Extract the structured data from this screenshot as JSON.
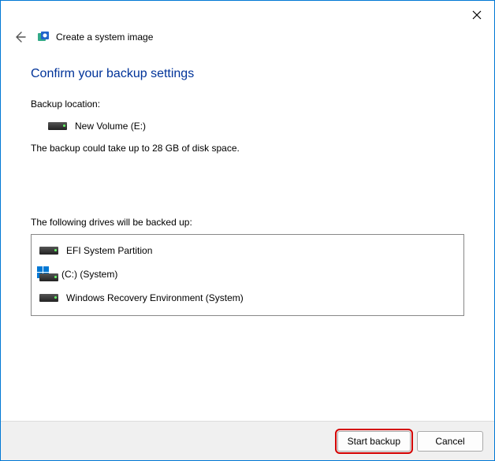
{
  "window": {
    "title": "Create a system image"
  },
  "heading": "Confirm your backup settings",
  "backup_location": {
    "label": "Backup location:",
    "value": "New Volume (E:)"
  },
  "size_note": "The backup could take up to 28 GB of disk space.",
  "drives_section": {
    "label": "The following drives will be backed up:",
    "items": [
      "EFI System Partition",
      "(C:) (System)",
      "Windows Recovery Environment (System)"
    ]
  },
  "footer": {
    "start_label": "Start backup",
    "cancel_label": "Cancel"
  }
}
